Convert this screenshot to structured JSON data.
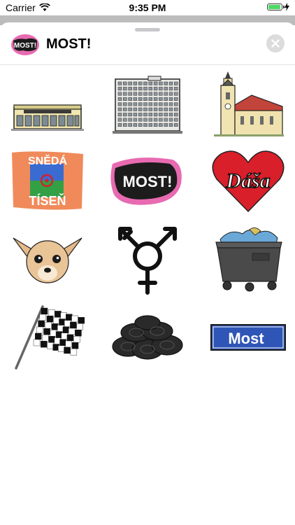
{
  "status_bar": {
    "carrier": "Carrier",
    "time": "9:35 PM",
    "battery_level": 0.95
  },
  "header": {
    "app_title": "MOST!",
    "icon_text": "MOST!",
    "close_icon": "close-icon"
  },
  "stickers": [
    {
      "name": "store-building",
      "text": ""
    },
    {
      "name": "apartment-block",
      "text": ""
    },
    {
      "name": "church",
      "text": ""
    },
    {
      "name": "sneda-tisen-flag",
      "top": "SNĚDÁ",
      "bottom": "TÍSEŇ"
    },
    {
      "name": "most-logo",
      "text": "MOST!"
    },
    {
      "name": "dasa-heart",
      "text": "Dáša"
    },
    {
      "name": "chihuahua",
      "text": ""
    },
    {
      "name": "gender-symbol",
      "text": ""
    },
    {
      "name": "trash-container",
      "text": ""
    },
    {
      "name": "checkered-flag",
      "text": ""
    },
    {
      "name": "tire-pile",
      "text": ""
    },
    {
      "name": "most-sign",
      "text": "Most"
    }
  ],
  "colors": {
    "pink": "#e86bb1",
    "blue": "#2f55b6",
    "red": "#d81f2a",
    "orange": "#f08a5a"
  }
}
